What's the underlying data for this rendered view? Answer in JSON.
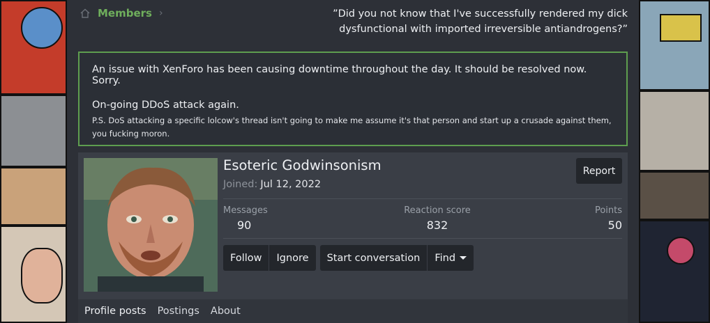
{
  "breadcrumb": {
    "label": "Members",
    "icon": "home-icon"
  },
  "quote": "”Did you not know that I've successfully rendered my dick dysfunctional with imported irreversible antiandrogens?”",
  "notice": {
    "line1": "An issue with XenForo has been causing downtime throughout the day. It should be resolved now. Sorry.",
    "line2": "On-going DDoS attack again.",
    "line3": "P.S. DoS attacking a specific lolcow's thread isn't going to make me assume it's that person and start up a crusade against them, you fucking moron."
  },
  "profile": {
    "name": "Esoteric Godwinsonism",
    "joined_label": "Joined:",
    "joined_value": "Jul 12, 2022",
    "report_label": "Report",
    "stats": {
      "messages_label": "Messages",
      "messages_value": "90",
      "reaction_label": "Reaction score",
      "reaction_value": "832",
      "points_label": "Points",
      "points_value": "50"
    },
    "buttons": {
      "follow": "Follow",
      "ignore": "Ignore",
      "start_conversation": "Start conversation",
      "find": "Find"
    },
    "tabs": [
      "Profile posts",
      "Postings",
      "About"
    ]
  },
  "colors": {
    "accent": "#6fae5c",
    "notice_border": "#5e9e4f"
  }
}
